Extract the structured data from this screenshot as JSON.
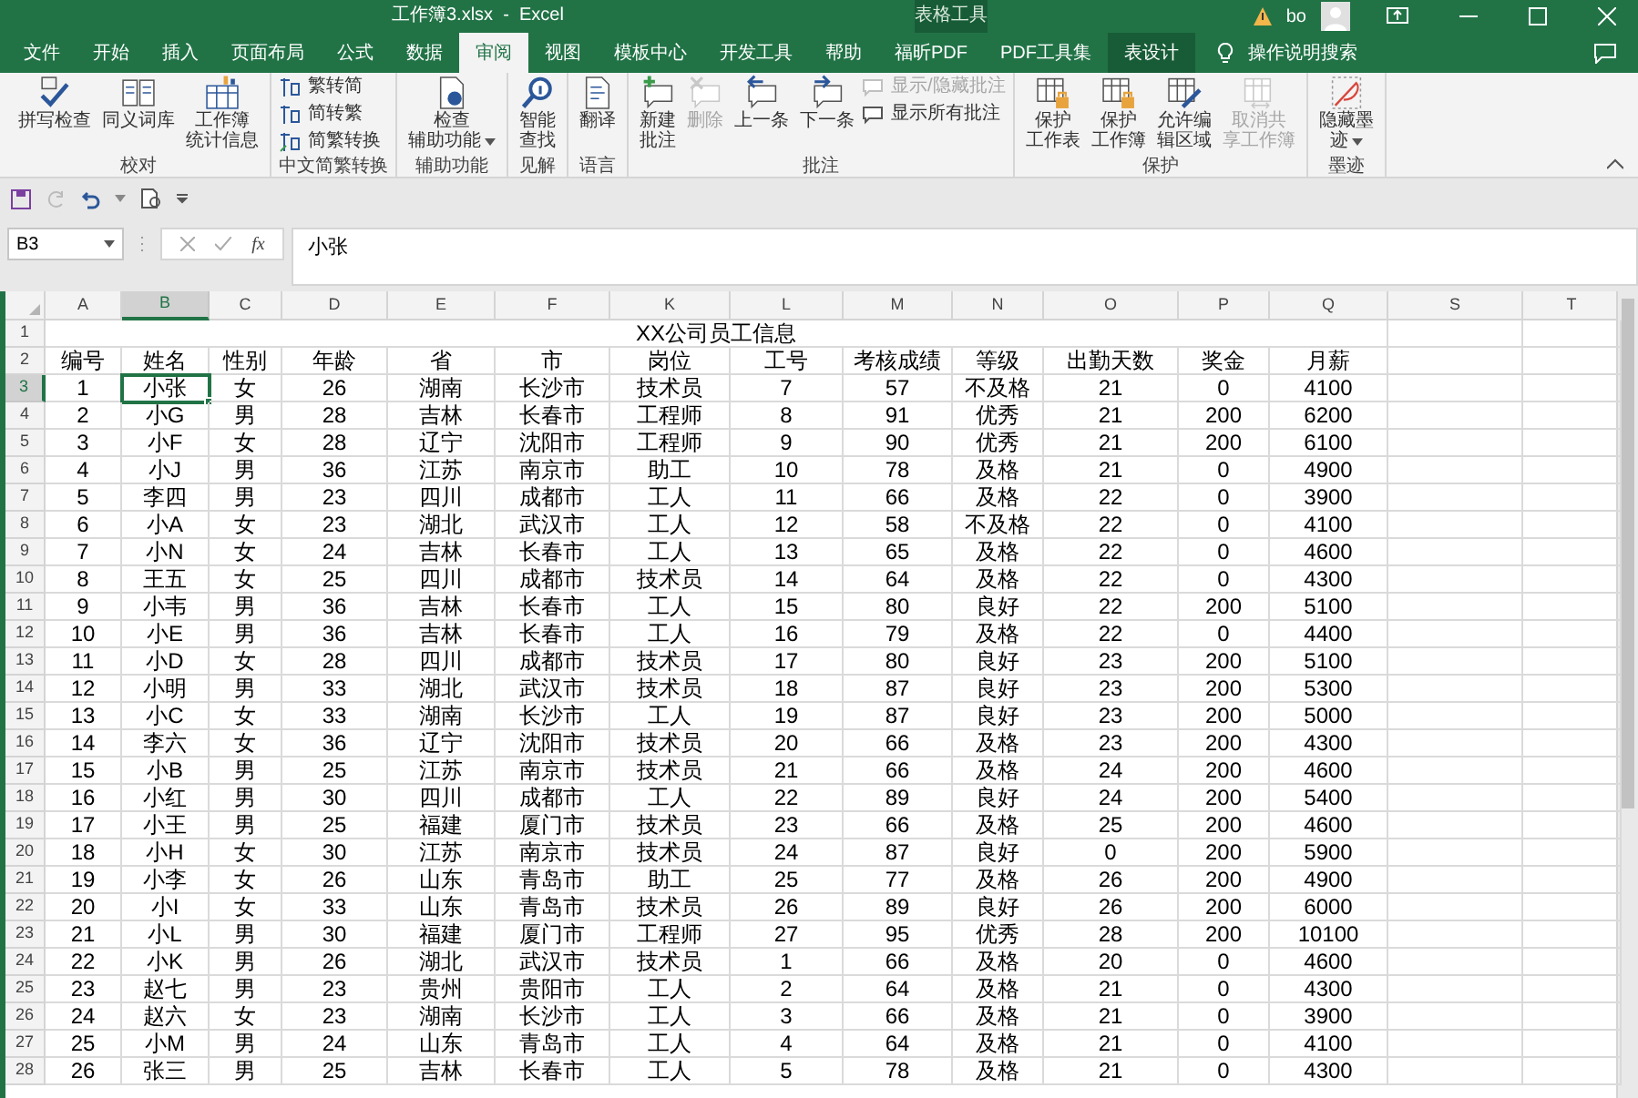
{
  "window": {
    "title": "工作簿3.xlsx  -  Excel",
    "context_group": "表格工具",
    "user": "bo"
  },
  "tabs": [
    {
      "label": "文件",
      "selected": false,
      "kind": "normal"
    },
    {
      "label": "开始",
      "selected": false,
      "kind": "normal"
    },
    {
      "label": "插入",
      "selected": false,
      "kind": "normal"
    },
    {
      "label": "页面布局",
      "selected": false,
      "kind": "normal"
    },
    {
      "label": "公式",
      "selected": false,
      "kind": "normal"
    },
    {
      "label": "数据",
      "selected": false,
      "kind": "normal"
    },
    {
      "label": "审阅",
      "selected": true,
      "kind": "normal"
    },
    {
      "label": "视图",
      "selected": false,
      "kind": "normal"
    },
    {
      "label": "模板中心",
      "selected": false,
      "kind": "normal"
    },
    {
      "label": "开发工具",
      "selected": false,
      "kind": "normal"
    },
    {
      "label": "帮助",
      "selected": false,
      "kind": "normal"
    },
    {
      "label": "福昕PDF",
      "selected": false,
      "kind": "normal"
    },
    {
      "label": "PDF工具集",
      "selected": false,
      "kind": "normal"
    },
    {
      "label": "表设计",
      "selected": false,
      "kind": "contextual"
    }
  ],
  "tell_me": "操作说明搜索",
  "ribbon": [
    {
      "label": "校对",
      "buttons": [
        {
          "lines": [
            "拼写检查"
          ],
          "kind": "large",
          "disabled": false,
          "dropdown": false
        },
        {
          "lines": [
            "同义词库"
          ],
          "kind": "large",
          "disabled": false,
          "dropdown": false
        },
        {
          "lines": [
            "工作簿",
            "统计信息"
          ],
          "kind": "large",
          "disabled": false,
          "dropdown": false
        }
      ]
    },
    {
      "label": "中文简繁转换",
      "buttons": [
        {
          "label": "繁转简",
          "kind": "small",
          "disabled": false,
          "dropdown": false
        },
        {
          "label": "简转繁",
          "kind": "small",
          "disabled": false,
          "dropdown": false
        },
        {
          "label": "简繁转换",
          "kind": "small",
          "disabled": false,
          "dropdown": false
        }
      ]
    },
    {
      "label": "辅助功能",
      "buttons": [
        {
          "lines": [
            "检查",
            "辅助功能"
          ],
          "kind": "large",
          "disabled": false,
          "dropdown": true
        }
      ]
    },
    {
      "label": "见解",
      "buttons": [
        {
          "lines": [
            "智能",
            "查找"
          ],
          "kind": "large",
          "disabled": false,
          "dropdown": false
        }
      ]
    },
    {
      "label": "语言",
      "buttons": [
        {
          "lines": [
            "翻译"
          ],
          "kind": "large",
          "disabled": false,
          "dropdown": false
        }
      ]
    },
    {
      "label": "批注",
      "buttons": [
        {
          "lines": [
            "新建",
            "批注"
          ],
          "kind": "large",
          "disabled": false,
          "dropdown": false
        },
        {
          "lines": [
            "删除"
          ],
          "kind": "large",
          "disabled": true,
          "dropdown": false
        },
        {
          "lines": [
            "上一条"
          ],
          "kind": "large",
          "disabled": false,
          "dropdown": false
        },
        {
          "lines": [
            "下一条"
          ],
          "kind": "large",
          "disabled": false,
          "dropdown": false
        },
        {
          "label": "显示/隐藏批注",
          "kind": "small",
          "disabled": true,
          "dropdown": false
        },
        {
          "label": "显示所有批注",
          "kind": "small",
          "disabled": false,
          "dropdown": false
        }
      ]
    },
    {
      "label": "保护",
      "buttons": [
        {
          "lines": [
            "保护",
            "工作表"
          ],
          "kind": "large",
          "disabled": false,
          "dropdown": false
        },
        {
          "lines": [
            "保护",
            "工作簿"
          ],
          "kind": "large",
          "disabled": false,
          "dropdown": false
        },
        {
          "lines": [
            "允许编",
            "辑区域"
          ],
          "kind": "large",
          "disabled": false,
          "dropdown": false
        },
        {
          "lines": [
            "取消共",
            "享工作簿"
          ],
          "kind": "large",
          "disabled": true,
          "dropdown": false
        }
      ]
    },
    {
      "label": "墨迹",
      "buttons": [
        {
          "lines": [
            "隐藏墨",
            "迹"
          ],
          "kind": "large",
          "disabled": false,
          "dropdown": true
        }
      ]
    }
  ],
  "name_box": "B3",
  "function_label": "fx",
  "formula": "小张",
  "sheet": {
    "columns": [
      {
        "label": "A",
        "selected": false
      },
      {
        "label": "B",
        "selected": true
      },
      {
        "label": "C",
        "selected": false
      },
      {
        "label": "D",
        "selected": false
      },
      {
        "label": "E",
        "selected": false
      },
      {
        "label": "F",
        "selected": false
      },
      {
        "label": "K",
        "selected": false
      },
      {
        "label": "L",
        "selected": false
      },
      {
        "label": "M",
        "selected": false
      },
      {
        "label": "N",
        "selected": false
      },
      {
        "label": "O",
        "selected": false
      },
      {
        "label": "P",
        "selected": false
      },
      {
        "label": "Q",
        "selected": false
      },
      {
        "label": "S",
        "selected": false
      },
      {
        "label": "T",
        "selected": false
      }
    ],
    "title_row": {
      "number": "1",
      "text": "XX公司员工信息"
    },
    "header_row": {
      "number": "2",
      "cells": [
        "编号",
        "姓名",
        "性别",
        "年龄",
        "省",
        "市",
        "岗位",
        "工号",
        "考核成绩",
        "等级",
        "出勤天数",
        "奖金",
        "月薪"
      ]
    },
    "rows": [
      {
        "number": "3",
        "selected": true,
        "cells": [
          "1",
          "小张",
          "女",
          "26",
          "湖南",
          "长沙市",
          "技术员",
          "7",
          "57",
          "不及格",
          "21",
          "0",
          "4100"
        ]
      },
      {
        "number": "4",
        "selected": false,
        "cells": [
          "2",
          "小G",
          "男",
          "28",
          "吉林",
          "长春市",
          "工程师",
          "8",
          "91",
          "优秀",
          "21",
          "200",
          "6200"
        ]
      },
      {
        "number": "5",
        "selected": false,
        "cells": [
          "3",
          "小F",
          "女",
          "28",
          "辽宁",
          "沈阳市",
          "工程师",
          "9",
          "90",
          "优秀",
          "21",
          "200",
          "6100"
        ]
      },
      {
        "number": "6",
        "selected": false,
        "cells": [
          "4",
          "小J",
          "男",
          "36",
          "江苏",
          "南京市",
          "助工",
          "10",
          "78",
          "及格",
          "21",
          "0",
          "4900"
        ]
      },
      {
        "number": "7",
        "selected": false,
        "cells": [
          "5",
          "李四",
          "男",
          "23",
          "四川",
          "成都市",
          "工人",
          "11",
          "66",
          "及格",
          "22",
          "0",
          "3900"
        ]
      },
      {
        "number": "8",
        "selected": false,
        "cells": [
          "6",
          "小A",
          "女",
          "23",
          "湖北",
          "武汉市",
          "工人",
          "12",
          "58",
          "不及格",
          "22",
          "0",
          "4100"
        ]
      },
      {
        "number": "9",
        "selected": false,
        "cells": [
          "7",
          "小N",
          "女",
          "24",
          "吉林",
          "长春市",
          "工人",
          "13",
          "65",
          "及格",
          "22",
          "0",
          "4600"
        ]
      },
      {
        "number": "10",
        "selected": false,
        "cells": [
          "8",
          "王五",
          "女",
          "25",
          "四川",
          "成都市",
          "技术员",
          "14",
          "64",
          "及格",
          "22",
          "0",
          "4300"
        ]
      },
      {
        "number": "11",
        "selected": false,
        "cells": [
          "9",
          "小韦",
          "男",
          "36",
          "吉林",
          "长春市",
          "工人",
          "15",
          "80",
          "良好",
          "22",
          "200",
          "5100"
        ]
      },
      {
        "number": "12",
        "selected": false,
        "cells": [
          "10",
          "小E",
          "男",
          "36",
          "吉林",
          "长春市",
          "工人",
          "16",
          "79",
          "及格",
          "22",
          "0",
          "4400"
        ]
      },
      {
        "number": "13",
        "selected": false,
        "cells": [
          "11",
          "小D",
          "女",
          "28",
          "四川",
          "成都市",
          "技术员",
          "17",
          "80",
          "良好",
          "23",
          "200",
          "5100"
        ]
      },
      {
        "number": "14",
        "selected": false,
        "cells": [
          "12",
          "小明",
          "男",
          "33",
          "湖北",
          "武汉市",
          "技术员",
          "18",
          "87",
          "良好",
          "23",
          "200",
          "5300"
        ]
      },
      {
        "number": "15",
        "selected": false,
        "cells": [
          "13",
          "小C",
          "女",
          "33",
          "湖南",
          "长沙市",
          "工人",
          "19",
          "87",
          "良好",
          "23",
          "200",
          "5000"
        ]
      },
      {
        "number": "16",
        "selected": false,
        "cells": [
          "14",
          "李六",
          "女",
          "36",
          "辽宁",
          "沈阳市",
          "技术员",
          "20",
          "66",
          "及格",
          "23",
          "200",
          "4300"
        ]
      },
      {
        "number": "17",
        "selected": false,
        "cells": [
          "15",
          "小B",
          "男",
          "25",
          "江苏",
          "南京市",
          "技术员",
          "21",
          "66",
          "及格",
          "24",
          "200",
          "4600"
        ]
      },
      {
        "number": "18",
        "selected": false,
        "cells": [
          "16",
          "小红",
          "男",
          "30",
          "四川",
          "成都市",
          "工人",
          "22",
          "89",
          "良好",
          "24",
          "200",
          "5400"
        ]
      },
      {
        "number": "19",
        "selected": false,
        "cells": [
          "17",
          "小王",
          "男",
          "25",
          "福建",
          "厦门市",
          "技术员",
          "23",
          "66",
          "及格",
          "25",
          "200",
          "4600"
        ]
      },
      {
        "number": "20",
        "selected": false,
        "cells": [
          "18",
          "小H",
          "女",
          "30",
          "江苏",
          "南京市",
          "技术员",
          "24",
          "87",
          "良好",
          "0",
          "200",
          "5900"
        ]
      },
      {
        "number": "21",
        "selected": false,
        "cells": [
          "19",
          "小李",
          "女",
          "26",
          "山东",
          "青岛市",
          "助工",
          "25",
          "77",
          "及格",
          "26",
          "200",
          "4900"
        ]
      },
      {
        "number": "22",
        "selected": false,
        "cells": [
          "20",
          "小I",
          "女",
          "33",
          "山东",
          "青岛市",
          "技术员",
          "26",
          "89",
          "良好",
          "26",
          "200",
          "6000"
        ]
      },
      {
        "number": "23",
        "selected": false,
        "cells": [
          "21",
          "小L",
          "男",
          "30",
          "福建",
          "厦门市",
          "工程师",
          "27",
          "95",
          "优秀",
          "28",
          "200",
          "10100"
        ]
      },
      {
        "number": "24",
        "selected": false,
        "cells": [
          "22",
          "小K",
          "男",
          "26",
          "湖北",
          "武汉市",
          "技术员",
          "1",
          "66",
          "及格",
          "20",
          "0",
          "4600"
        ]
      },
      {
        "number": "25",
        "selected": false,
        "cells": [
          "23",
          "赵七",
          "男",
          "23",
          "贵州",
          "贵阳市",
          "工人",
          "2",
          "64",
          "及格",
          "21",
          "0",
          "4300"
        ]
      },
      {
        "number": "26",
        "selected": false,
        "cells": [
          "24",
          "赵六",
          "女",
          "23",
          "湖南",
          "长沙市",
          "工人",
          "3",
          "66",
          "及格",
          "21",
          "0",
          "3900"
        ]
      },
      {
        "number": "27",
        "selected": false,
        "cells": [
          "25",
          "小M",
          "男",
          "24",
          "山东",
          "青岛市",
          "工人",
          "4",
          "64",
          "及格",
          "21",
          "0",
          "4100"
        ]
      },
      {
        "number": "28",
        "selected": false,
        "cells": [
          "26",
          "张三",
          "男",
          "25",
          "吉林",
          "长春市",
          "工人",
          "5",
          "78",
          "及格",
          "21",
          "0",
          "4300"
        ]
      }
    ]
  }
}
